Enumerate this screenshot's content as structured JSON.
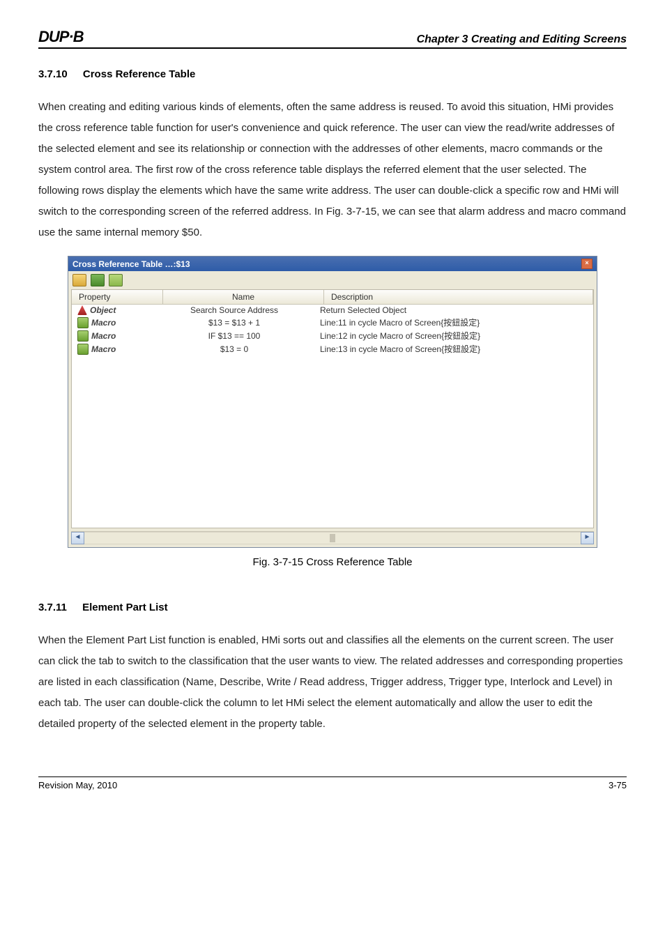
{
  "header": {
    "logo": "DUP·B",
    "chapter": "Chapter 3 Creating and Editing Screens"
  },
  "section1": {
    "number": "3.7.10",
    "title": "Cross Reference Table",
    "paragraph": "When creating and editing various kinds of elements, often the same address is reused. To avoid this situation, HMi provides the cross reference table function for user's convenience and quick reference. The user can view the read/write addresses of the selected element and see its relationship or connection with the addresses of other elements, macro commands or the system control area. The first row of the cross reference table displays the referred element that the user selected. The following rows display the elements which have the same write address. The user can double-click a specific row and HMi will switch to the corresponding screen of the referred address. In Fig. 3-7-15, we can see that alarm address and macro command use the same internal memory $50."
  },
  "window": {
    "title": "Cross Reference Table …:$13",
    "columns": {
      "property": "Property",
      "name": "Name",
      "description": "Description"
    },
    "rows": [
      {
        "icon": "obj",
        "property": "Object",
        "name": "Search Source Address",
        "description": "Return Selected Object"
      },
      {
        "icon": "macro",
        "property": "Macro",
        "name": "$13 = $13 + 1",
        "description": "Line:11  in cycle Macro of Screen{按鈕設定}"
      },
      {
        "icon": "macro",
        "property": "Macro",
        "name": "IF $13 == 100",
        "description": "Line:12  in cycle Macro of Screen{按鈕設定}"
      },
      {
        "icon": "macro",
        "property": "Macro",
        "name": "$13 = 0",
        "description": "Line:13  in cycle Macro of Screen{按鈕設定}"
      }
    ]
  },
  "figure_caption": "Fig. 3-7-15 Cross Reference Table",
  "section2": {
    "number": "3.7.11",
    "title": "Element Part List",
    "paragraph": "When the Element Part List function is enabled, HMi sorts out and classifies all the elements on the current screen. The user can click the tab to switch to the classification that the user wants to view. The related addresses and corresponding properties are listed in each classification (Name, Describe, Write / Read address, Trigger address, Trigger type, Interlock and Level) in each tab. The user can double-click the column to let HMi select the element automatically and allow the user to edit the detailed property of the selected element in the property table."
  },
  "footer": {
    "left": "Revision May, 2010",
    "right": "3-75"
  }
}
